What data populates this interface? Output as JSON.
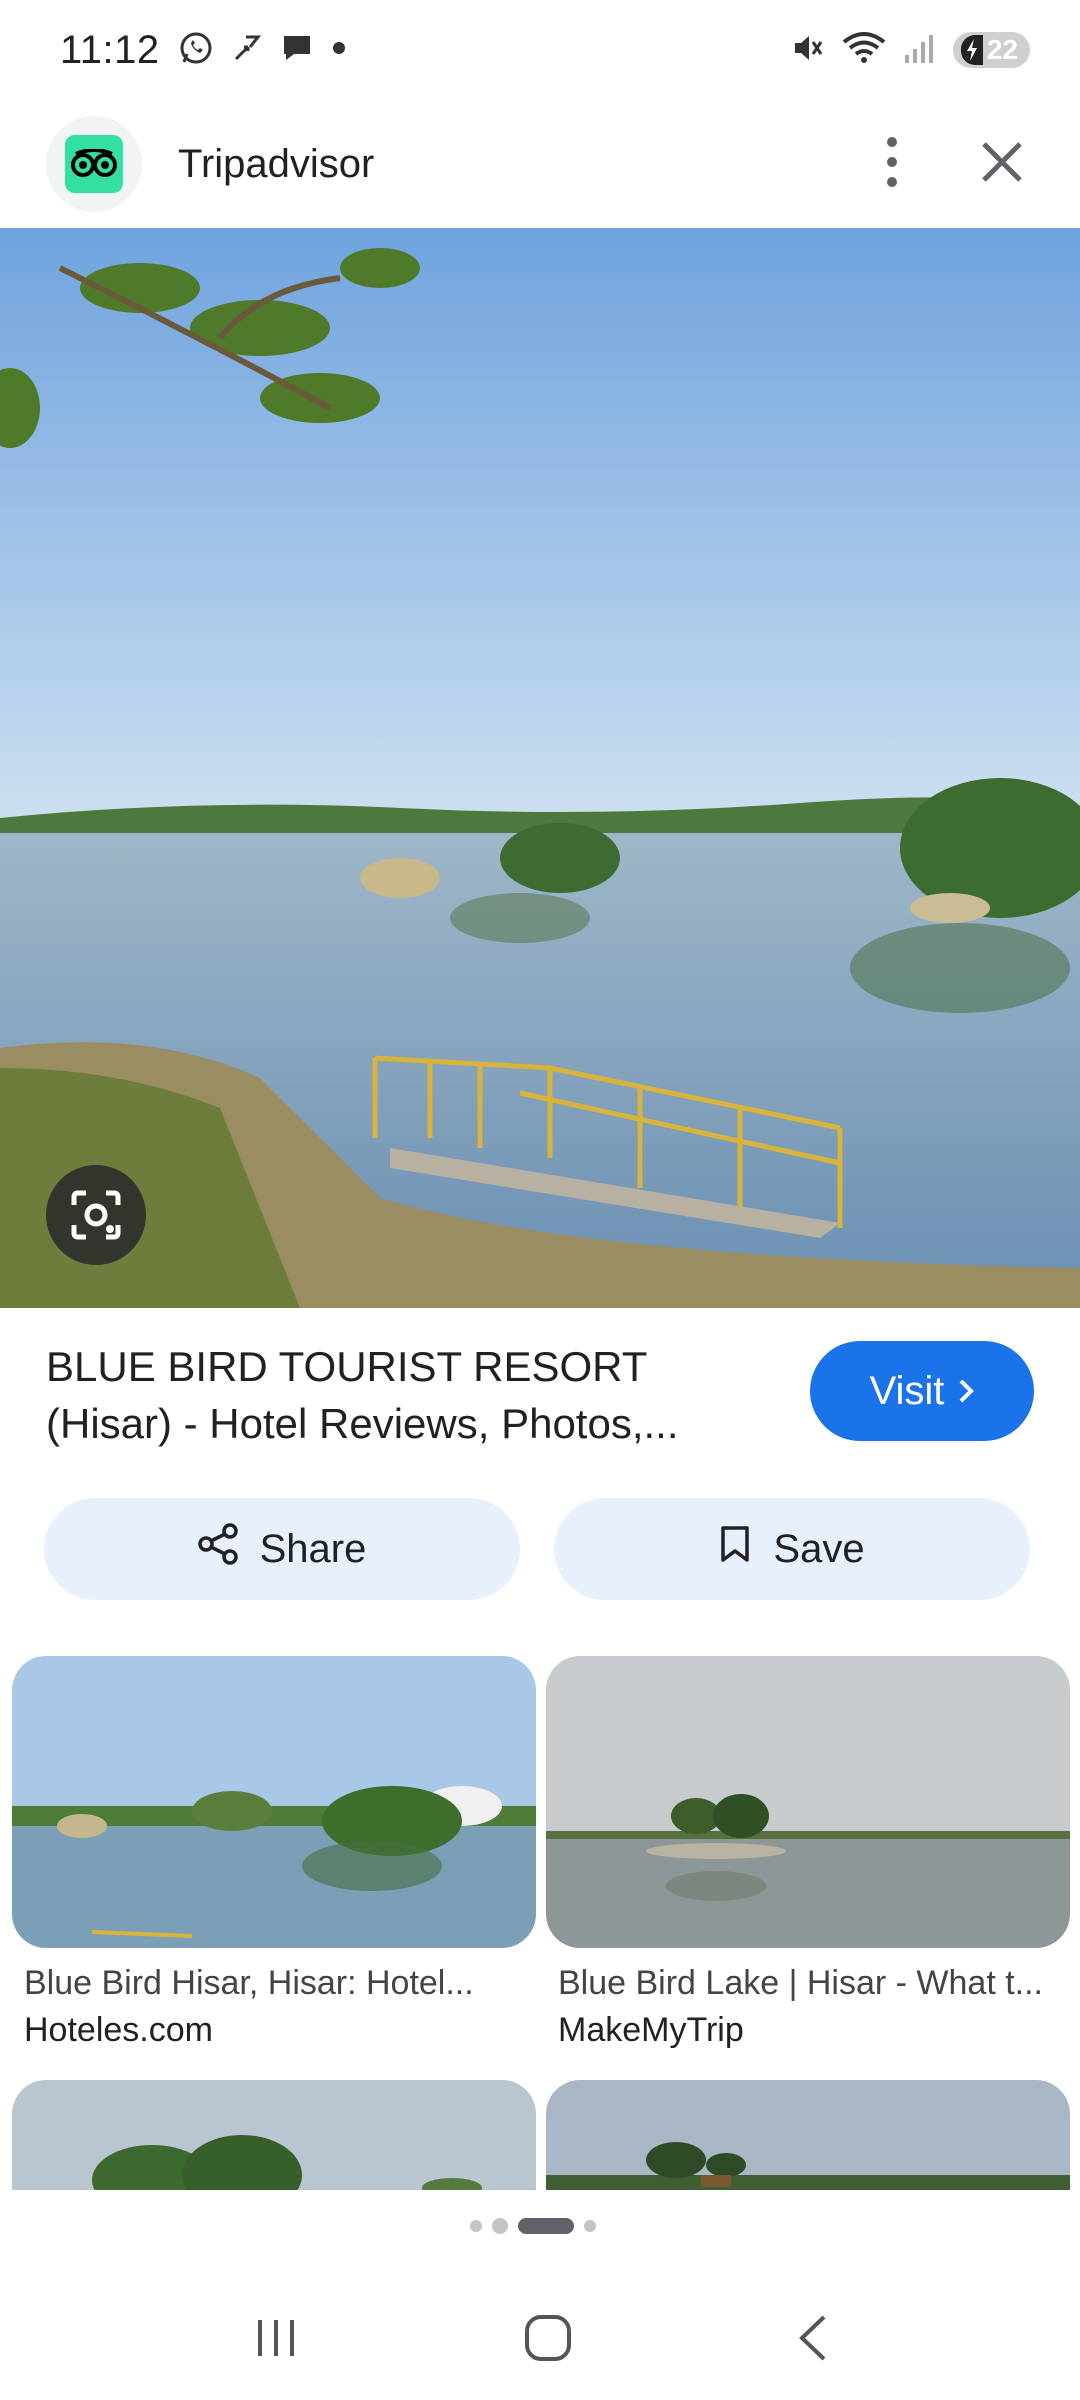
{
  "status_bar": {
    "time": "11:12",
    "battery": "22",
    "left_icons": [
      "whatsapp-icon",
      "missed-call-icon",
      "message-icon",
      "dot-icon"
    ],
    "right_icons": [
      "mute-icon",
      "wifi-icon",
      "signal-icon",
      "battery-icon"
    ]
  },
  "header": {
    "site_name": "Tripadvisor",
    "logo_color": "#34e0a1"
  },
  "result": {
    "title": "BLUE BIRD TOURIST RESORT (Hisar) - Hotel Reviews, Photos,...",
    "visit_label": "Visit",
    "share_label": "Share",
    "save_label": "Save",
    "accent": "#1a73e8"
  },
  "related": [
    {
      "caption": "Blue Bird Hisar, Hisar: Hotel...",
      "source": "Hoteles.com"
    },
    {
      "caption": "Blue Bird Lake | Hisar - What t...",
      "source": "MakeMyTrip"
    }
  ],
  "pager": {
    "pages": 4,
    "active": 2
  }
}
